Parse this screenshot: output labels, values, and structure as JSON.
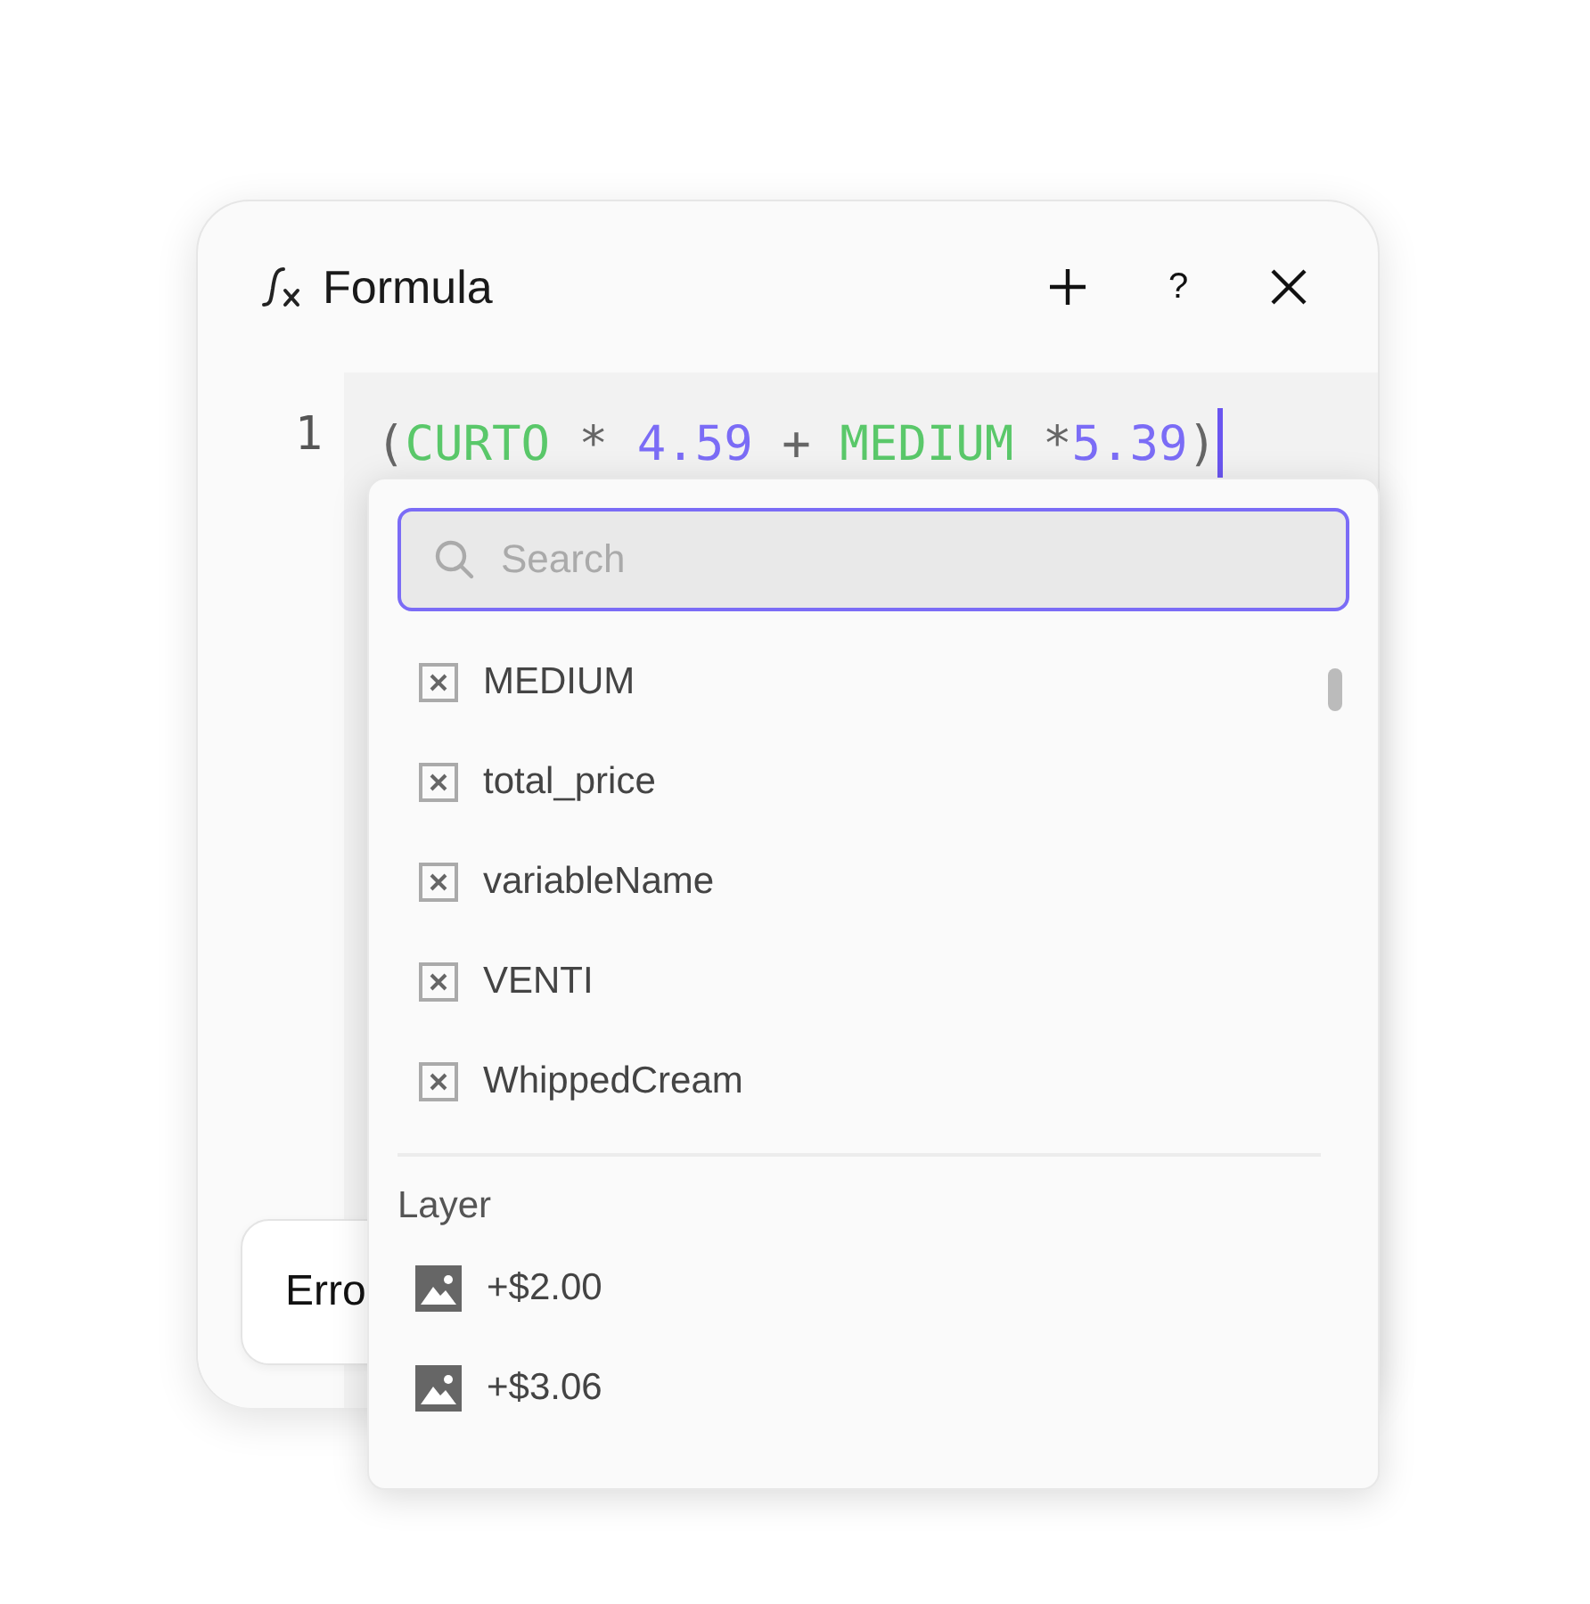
{
  "window": {
    "title": "Formula",
    "actions": [
      {
        "kind": "add"
      },
      {
        "kind": "help",
        "label": "?"
      },
      {
        "kind": "close"
      }
    ]
  },
  "editor": {
    "line_number": "1",
    "tokens": [
      {
        "kind": "punct",
        "text": "("
      },
      {
        "kind": "var",
        "text": "CURTO"
      },
      {
        "kind": "op",
        "text": " * "
      },
      {
        "kind": "num",
        "text": "4.59"
      },
      {
        "kind": "op",
        "text": " + "
      },
      {
        "kind": "var",
        "text": "MEDIUM"
      },
      {
        "kind": "op",
        "text": " *"
      },
      {
        "kind": "num",
        "text": "5.39"
      },
      {
        "kind": "punct",
        "text": ")"
      }
    ]
  },
  "error_button": {
    "label": "Erro"
  },
  "dropdown": {
    "search": {
      "placeholder": "Search"
    },
    "variables": [
      {
        "label": "MEDIUM"
      },
      {
        "label": "total_price"
      },
      {
        "label": "variableName"
      },
      {
        "label": "VENTI"
      },
      {
        "label": "WhippedCream"
      }
    ],
    "section_title": "Layer",
    "layers": [
      {
        "label": "+$2.00"
      },
      {
        "label": "+$3.06"
      }
    ]
  }
}
